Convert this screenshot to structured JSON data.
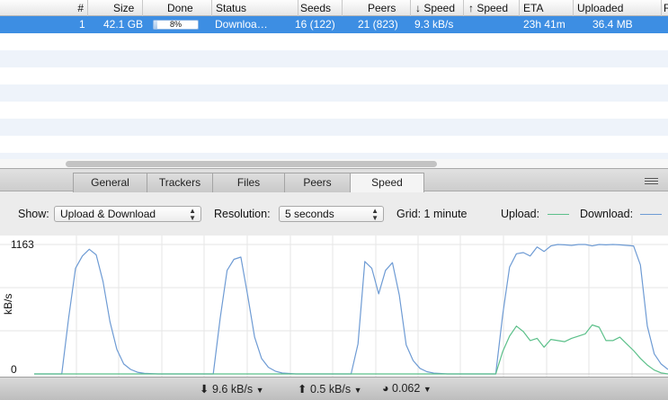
{
  "table": {
    "columns": [
      "#",
      "Size",
      "Done",
      "Status",
      "Seeds",
      "Peers",
      "↓ Speed",
      "↑ Speed",
      "ETA",
      "Uploaded",
      "R"
    ],
    "row": {
      "index": "1",
      "size": "42.1 GB",
      "done_text": "8%",
      "done_fraction": 0.08,
      "status": "Downloa…",
      "seeds": "16 (122)",
      "peers": "21 (823)",
      "down_speed": "9.3 kB/s",
      "up_speed": "",
      "eta": "23h 41m",
      "uploaded": "36.4 MB"
    }
  },
  "tabs": [
    "General",
    "Trackers",
    "Files",
    "Peers",
    "Speed"
  ],
  "active_tab": "Speed",
  "options": {
    "show_label": "Show:",
    "show_value": "Upload & Download",
    "resolution_label": "Resolution:",
    "resolution_value": "5 seconds",
    "grid_label": "Grid: 1 minute",
    "upload_label": "Upload:",
    "download_label": "Download:"
  },
  "colors": {
    "upload": "#5cc08a",
    "download": "#6e9bd4",
    "selection": "#3d8ee3"
  },
  "chart_data": {
    "type": "line",
    "ylabel": "kB/s",
    "y_tick_labels": [
      "1163",
      "0"
    ],
    "ylim": [
      0,
      1163
    ],
    "grid": true,
    "x_step": 1,
    "series": [
      {
        "name": "Download",
        "values": [
          0,
          0,
          0,
          0,
          0,
          0,
          0,
          0,
          0,
          0,
          0,
          0,
          0,
          0,
          0,
          0,
          0,
          0,
          0,
          0,
          0,
          0,
          0,
          0,
          0,
          0,
          0,
          0,
          0,
          0,
          0,
          0,
          0,
          0,
          0,
          0,
          0,
          0,
          0,
          0,
          0,
          0,
          0,
          0,
          0,
          0,
          0,
          0,
          0,
          0,
          0,
          0,
          0,
          0,
          0,
          0,
          0,
          0,
          0,
          0,
          0,
          0,
          0,
          0,
          0,
          0,
          0,
          0,
          0,
          0,
          0,
          0,
          0,
          0,
          0,
          0,
          0,
          0,
          0,
          0,
          0,
          0,
          0,
          0,
          0,
          0,
          0,
          0,
          0,
          0,
          0,
          0,
          0,
          0,
          0,
          0,
          0,
          0,
          0,
          0,
          0,
          0,
          0,
          0,
          0,
          0,
          0,
          0,
          0,
          0,
          0,
          0,
          0,
          0,
          0,
          0,
          0,
          0,
          0,
          0,
          0,
          0,
          0,
          0,
          0,
          0,
          0,
          0,
          0,
          0,
          0,
          0,
          0,
          0,
          0,
          0,
          0,
          0,
          0,
          0,
          0,
          0,
          0,
          0,
          0,
          0,
          0,
          0,
          0,
          0,
          0,
          0,
          0,
          0,
          0,
          0,
          0,
          0,
          0,
          0,
          0,
          0,
          0,
          0,
          0,
          0,
          0,
          0,
          0,
          0,
          0,
          0,
          0,
          0,
          0,
          0,
          0,
          0,
          0,
          0,
          0,
          0,
          0,
          0,
          0,
          0,
          0,
          0,
          0,
          0,
          0,
          0,
          0,
          0,
          0,
          0,
          0,
          0,
          0,
          0,
          0,
          0,
          0,
          0,
          0,
          0
        ]
      },
      {
        "name": "Upload",
        "values": []
      }
    ],
    "download_points": [
      [
        0,
        0
      ],
      [
        4,
        0
      ],
      [
        5,
        500
      ],
      [
        6,
        950
      ],
      [
        7,
        1060
      ],
      [
        8,
        1120
      ],
      [
        9,
        1070
      ],
      [
        10,
        830
      ],
      [
        11,
        470
      ],
      [
        12,
        220
      ],
      [
        13,
        90
      ],
      [
        14,
        40
      ],
      [
        15,
        15
      ],
      [
        16,
        5
      ],
      [
        18,
        0
      ],
      [
        26,
        0
      ],
      [
        27,
        500
      ],
      [
        28,
        930
      ],
      [
        29,
        1030
      ],
      [
        30,
        1050
      ],
      [
        31,
        700
      ],
      [
        32,
        330
      ],
      [
        33,
        140
      ],
      [
        34,
        60
      ],
      [
        35,
        25
      ],
      [
        36,
        8
      ],
      [
        38,
        0
      ],
      [
        46,
        0
      ],
      [
        47,
        270
      ],
      [
        48,
        1010
      ],
      [
        49,
        950
      ],
      [
        50,
        720
      ],
      [
        51,
        930
      ],
      [
        52,
        1000
      ],
      [
        53,
        710
      ],
      [
        54,
        260
      ],
      [
        55,
        120
      ],
      [
        56,
        50
      ],
      [
        57,
        20
      ],
      [
        58,
        7
      ],
      [
        60,
        0
      ],
      [
        67,
        0
      ],
      [
        68,
        530
      ],
      [
        69,
        960
      ],
      [
        70,
        1080
      ],
      [
        71,
        1090
      ],
      [
        72,
        1060
      ],
      [
        73,
        1140
      ],
      [
        74,
        1100
      ],
      [
        75,
        1150
      ],
      [
        76,
        1163
      ],
      [
        77,
        1160
      ],
      [
        78,
        1155
      ],
      [
        79,
        1163
      ],
      [
        80,
        1163
      ],
      [
        81,
        1150
      ],
      [
        82,
        1163
      ],
      [
        83,
        1160
      ],
      [
        84,
        1163
      ],
      [
        85,
        1160
      ],
      [
        86,
        1155
      ],
      [
        87,
        1150
      ],
      [
        88,
        980
      ],
      [
        89,
        430
      ],
      [
        90,
        180
      ],
      [
        91,
        90
      ],
      [
        92,
        40
      ]
    ],
    "upload_points": [
      [
        0,
        0
      ],
      [
        67,
        0
      ],
      [
        68,
        200
      ],
      [
        69,
        340
      ],
      [
        70,
        430
      ],
      [
        71,
        380
      ],
      [
        72,
        300
      ],
      [
        73,
        320
      ],
      [
        74,
        240
      ],
      [
        75,
        310
      ],
      [
        76,
        300
      ],
      [
        77,
        290
      ],
      [
        78,
        320
      ],
      [
        79,
        340
      ],
      [
        80,
        360
      ],
      [
        81,
        440
      ],
      [
        82,
        420
      ],
      [
        83,
        300
      ],
      [
        84,
        300
      ],
      [
        85,
        330
      ],
      [
        86,
        270
      ],
      [
        87,
        210
      ],
      [
        88,
        140
      ],
      [
        89,
        80
      ],
      [
        90,
        35
      ],
      [
        91,
        10
      ],
      [
        92,
        0
      ]
    ],
    "xlim": [
      0,
      92
    ]
  },
  "status_bar": {
    "down_speed": "9.6 kB/s",
    "up_speed": "0.5 kB/s",
    "ratio": "0.062"
  }
}
